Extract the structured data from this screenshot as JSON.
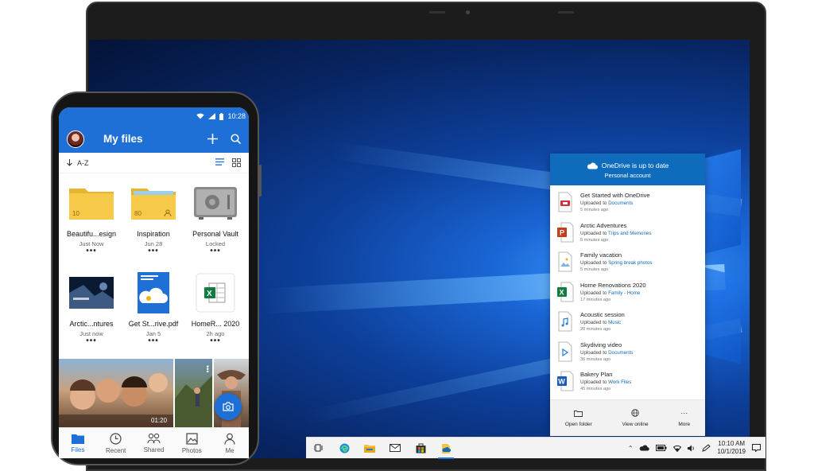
{
  "desktop": {
    "flyout": {
      "status": "OneDrive is up to date",
      "account": "Personal account",
      "items": [
        {
          "title": "Get Started with OneDrive",
          "prefix": "Uploaded to ",
          "location": "Documents",
          "time": "5 minutes ago",
          "icon": "pdf-file-icon"
        },
        {
          "title": "Arctic Adventures",
          "prefix": "Uploaded to ",
          "location": "Trips and Memories",
          "time": "5 minutes ago",
          "icon": "powerpoint-file-icon"
        },
        {
          "title": "Family vacation",
          "prefix": "Uploaded to ",
          "location": "Spring break photos",
          "time": "5 minutes ago",
          "icon": "image-file-icon"
        },
        {
          "title": "Home Renovations 2020",
          "prefix": "Uploaded to ",
          "location": "Family - Home",
          "time": "17 minutes ago",
          "icon": "excel-file-icon"
        },
        {
          "title": "Acoustic session",
          "prefix": "Uploaded to ",
          "location": "Music",
          "time": "20 minutes ago",
          "icon": "audio-file-icon"
        },
        {
          "title": "Skydiving video",
          "prefix": "Uploaded to ",
          "location": "Documents",
          "time": "36 minutes ago",
          "icon": "video-file-icon"
        },
        {
          "title": "Bakery Plan",
          "prefix": "Uploaded to ",
          "location": "Work Files",
          "time": "45 minutes ago",
          "icon": "word-file-icon"
        }
      ],
      "footer": {
        "open_folder": "Open folder",
        "view_online": "View online",
        "more": "More",
        "more_glyph": "···"
      }
    },
    "taskbar": {
      "time": "10:10 AM",
      "date": "10/1/2019",
      "apps": [
        "task-view-icon",
        "edge-icon",
        "file-explorer-icon",
        "mail-icon",
        "store-icon",
        "onedrive-app-icon"
      ]
    }
  },
  "phone": {
    "status_time": "10:28",
    "title": "My files",
    "sort_label": "A-Z",
    "tiles": [
      {
        "name": "Beautifu...esign",
        "meta": "Just Now",
        "kind": "folder",
        "count": "10"
      },
      {
        "name": "Inspiration",
        "meta": "Jun 28",
        "kind": "shared-folder",
        "count": "80"
      },
      {
        "name": "Personal Vault",
        "meta": "Locked",
        "kind": "vault"
      },
      {
        "name": "Arctic...ntures",
        "meta": "Just now",
        "kind": "pptx"
      },
      {
        "name": "Get St...rive.pdf",
        "meta": "Jan 5",
        "kind": "pdf"
      },
      {
        "name": "HomeR... 2020",
        "meta": "2h ago",
        "kind": "xlsx"
      }
    ],
    "tile_more": "•••",
    "video_duration": "01:20",
    "nav": [
      {
        "label": "Files",
        "icon": "folder-icon",
        "active": true
      },
      {
        "label": "Recent",
        "icon": "clock-icon",
        "active": false
      },
      {
        "label": "Shared",
        "icon": "people-icon",
        "active": false
      },
      {
        "label": "Photos",
        "icon": "photo-icon",
        "active": false
      },
      {
        "label": "Me",
        "icon": "person-icon",
        "active": false
      }
    ]
  },
  "colors": {
    "onedrive_blue": "#0f6cbd",
    "app_blue": "#1e70d6",
    "folder_yellow": "#f7c948"
  }
}
